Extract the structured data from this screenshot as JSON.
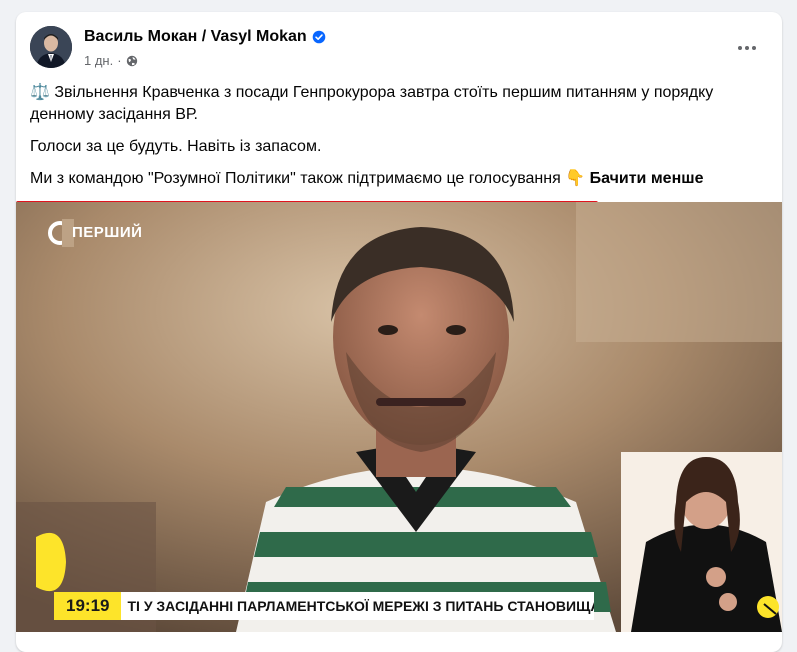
{
  "post": {
    "author": "Василь Мокан / Vasyl Mokan",
    "time": "1 дн.",
    "separator": "·",
    "more_icon": "more-horizontal-icon",
    "verified_icon": "verified-badge-icon",
    "audience_icon": "globe-icon",
    "paragraph1": "Звільнення Кравченка з посади Генпрокурора завтра стоїть першим питанням у порядку денному засідання ВР.",
    "paragraph1_emoji": "⚖️",
    "paragraph2": "Голоси за це будуть. Навіть із запасом.",
    "paragraph3": "Ми з командою \"Розумної Політики\" також підтримаємо це голосування",
    "paragraph3_emoji": "👇",
    "see_less": "Бачити менше"
  },
  "video": {
    "channel": "ПЕРШИЙ",
    "clock": "19:19",
    "ticker": "ТІ У ЗАСІДАННІ ПАРЛАМЕНТСЬКОЇ МЕРЕЖІ З ПИТАНЬ СТАНОВИЩА ДІТЕЙ"
  },
  "colors": {
    "accent_blue": "#0866ff",
    "underline_red": "#e0141e",
    "ticker_yellow": "#fde42a"
  }
}
